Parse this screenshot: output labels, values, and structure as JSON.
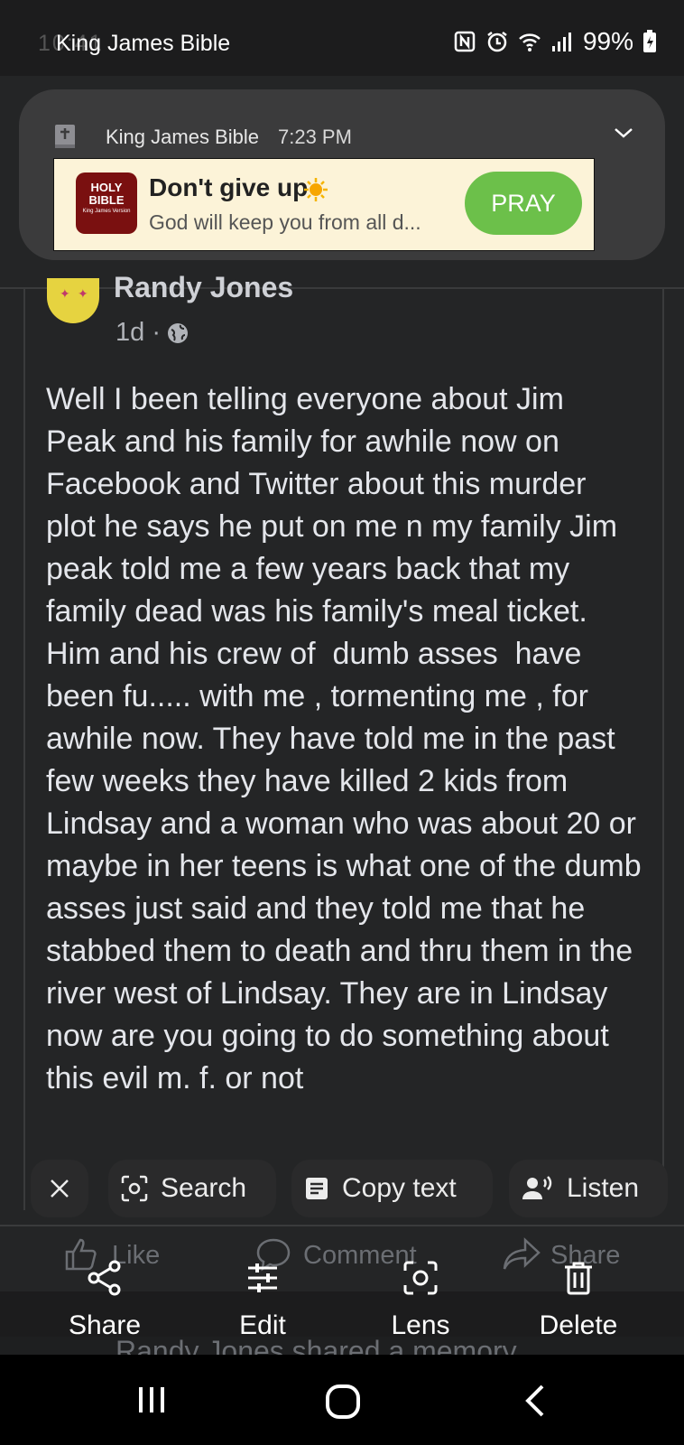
{
  "status_bar": {
    "app_title": "King James Bible",
    "ghost_time": "10:41",
    "battery": "99%"
  },
  "notification": {
    "app_name": "King James Bible",
    "time": "7:23 PM",
    "logo_text_1": "HOLY",
    "logo_text_2": "BIBLE",
    "logo_text_3": "King James Version",
    "title": "Don't give up",
    "subtitle": "God will keep you from all d...",
    "action_label": "PRAY"
  },
  "post": {
    "author": "Randy Jones",
    "time": "1d ·",
    "text": "Well I been telling everyone about Jim Peak and his family for awhile now on Facebook and Twitter about this murder plot he says he put on me n my family Jim peak told me a few years back that my family dead was his family's meal ticket. Him and his crew of  dumb asses  have been fu..... with me , tormenting me , for awhile now. They have told me in the past few weeks they have killed 2 kids from Lindsay and a woman who was about 20 or maybe in her teens is what one of the dumb asses just said and they told me that he stabbed them to death and thru them in the river west of Lindsay. They are in Lindsay now are you going to do something about this evil m. f. or not"
  },
  "lens_actions": {
    "search": "Search",
    "copy_text": "Copy text",
    "listen": "Listen"
  },
  "reactions": {
    "like": "Like",
    "comment": "Comment",
    "share": "Share"
  },
  "bottom_actions": {
    "share": "Share",
    "edit": "Edit",
    "lens": "Lens",
    "delete": "Delete"
  },
  "next_post": {
    "text": "Randy Jones shared a memory"
  }
}
